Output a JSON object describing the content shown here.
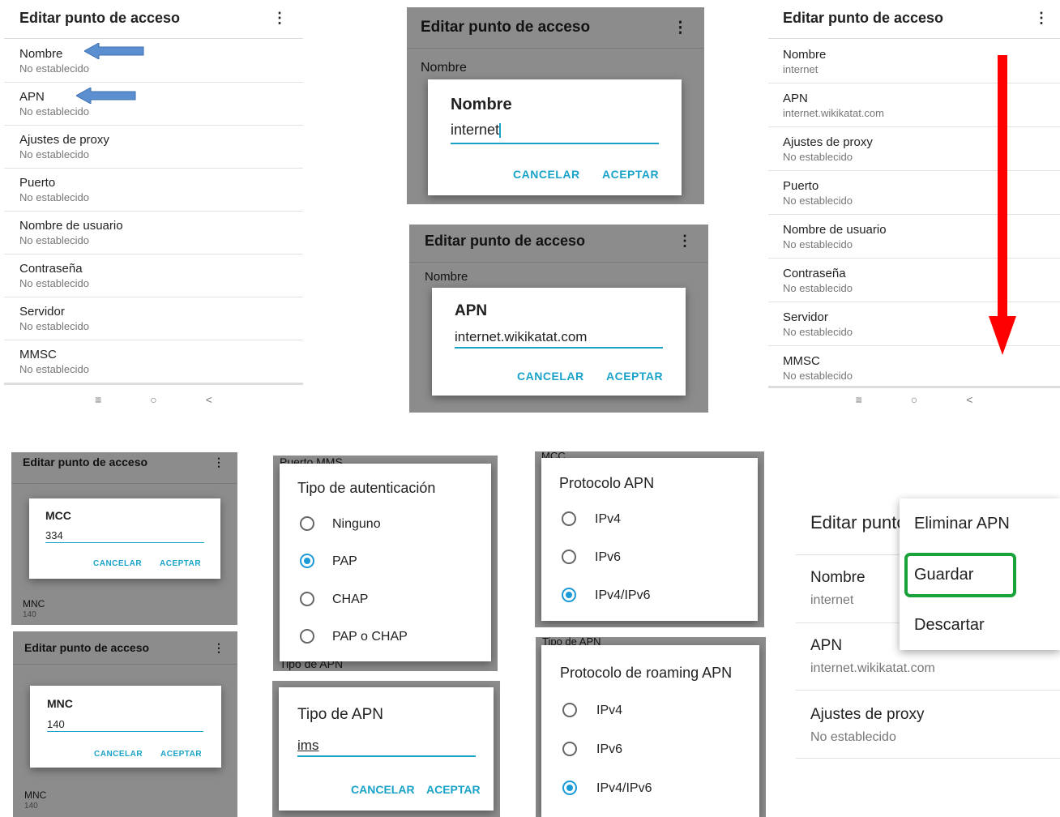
{
  "screen1": {
    "title": "Editar punto de acceso",
    "menu_icon": "more-vert-icon",
    "items": [
      {
        "label": "Nombre",
        "value": "No establecido"
      },
      {
        "label": "APN",
        "value": "No establecido"
      },
      {
        "label": "Ajustes de proxy",
        "value": "No establecido"
      },
      {
        "label": "Puerto",
        "value": "No establecido"
      },
      {
        "label": "Nombre de usuario",
        "value": "No establecido"
      },
      {
        "label": "Contraseña",
        "value": "No establecido"
      },
      {
        "label": "Servidor",
        "value": "No establecido"
      },
      {
        "label": "MMSC",
        "value": "No establecido"
      }
    ],
    "nav": [
      "≡",
      "○",
      "<"
    ]
  },
  "screen2": {
    "title": "Editar punto de acceso",
    "bg_item": "Nombre",
    "dialog": {
      "title": "Nombre",
      "value": "internet",
      "cancel": "CANCELAR",
      "ok": "ACEPTAR"
    }
  },
  "screen3": {
    "title": "Editar punto de acceso",
    "bg_item": "Nombre",
    "dialog": {
      "title": "APN",
      "value": "internet.wikikatat.com",
      "cancel": "CANCELAR",
      "ok": "ACEPTAR"
    }
  },
  "screen4": {
    "title": "Editar punto de acceso",
    "items": [
      {
        "label": "Nombre",
        "value": "internet"
      },
      {
        "label": "APN",
        "value": "internet.wikikatat.com"
      },
      {
        "label": "Ajustes de proxy",
        "value": "No establecido"
      },
      {
        "label": "Puerto",
        "value": "No establecido"
      },
      {
        "label": "Nombre de usuario",
        "value": "No establecido"
      },
      {
        "label": "Contraseña",
        "value": "No establecido"
      },
      {
        "label": "Servidor",
        "value": "No establecido"
      },
      {
        "label": "MMSC",
        "value": "No establecido"
      }
    ],
    "nav": [
      "≡",
      "○",
      "<"
    ]
  },
  "screen5": {
    "title": "Editar punto de acceso",
    "bg_item": "MNC",
    "bg_value": "140",
    "dialog": {
      "title": "MCC",
      "value": "334",
      "cancel": "CANCELAR",
      "ok": "ACEPTAR"
    }
  },
  "screen6": {
    "title": "Editar punto de acceso",
    "bg_item": "MNC",
    "bg_value": "140",
    "dialog": {
      "title": "MNC",
      "value": "140",
      "cancel": "CANCELAR",
      "ok": "ACEPTAR"
    }
  },
  "screen7": {
    "bg_top": "Puerto MMS",
    "bg_bottom": "Tipo de APN",
    "dialog": {
      "title": "Tipo de autenticación",
      "options": [
        "Ninguno",
        "PAP",
        "CHAP",
        "PAP o CHAP"
      ],
      "selected": 1
    }
  },
  "screen8": {
    "dialog": {
      "title": "Tipo de APN",
      "value": "ims",
      "cancel": "CANCELAR",
      "ok": "ACEPTAR"
    }
  },
  "screen9": {
    "bg_top": "MCC",
    "dialog": {
      "title": "Protocolo APN",
      "options": [
        "IPv4",
        "IPv6",
        "IPv4/IPv6"
      ],
      "selected": 2
    }
  },
  "screen10": {
    "bg_top": "Tipo de APN",
    "dialog": {
      "title": "Protocolo de roaming APN",
      "options": [
        "IPv4",
        "IPv6",
        "IPv4/IPv6"
      ],
      "selected": 2
    }
  },
  "screen11": {
    "title": "Editar punto de acceso",
    "items": [
      {
        "label": "Nombre",
        "value": "internet"
      },
      {
        "label": "APN",
        "value": "internet.wikikatat.com"
      },
      {
        "label": "Ajustes de proxy",
        "value": "No establecido"
      }
    ],
    "menu": [
      "Eliminar APN",
      "Guardar",
      "Descartar"
    ],
    "highlight_color": "#1aa33a"
  },
  "colors": {
    "accent": "#1aa3c8",
    "radio": "#1a9ad6",
    "arrow_red": "#ff0000",
    "arrow_blue": "#5b8fd0"
  }
}
